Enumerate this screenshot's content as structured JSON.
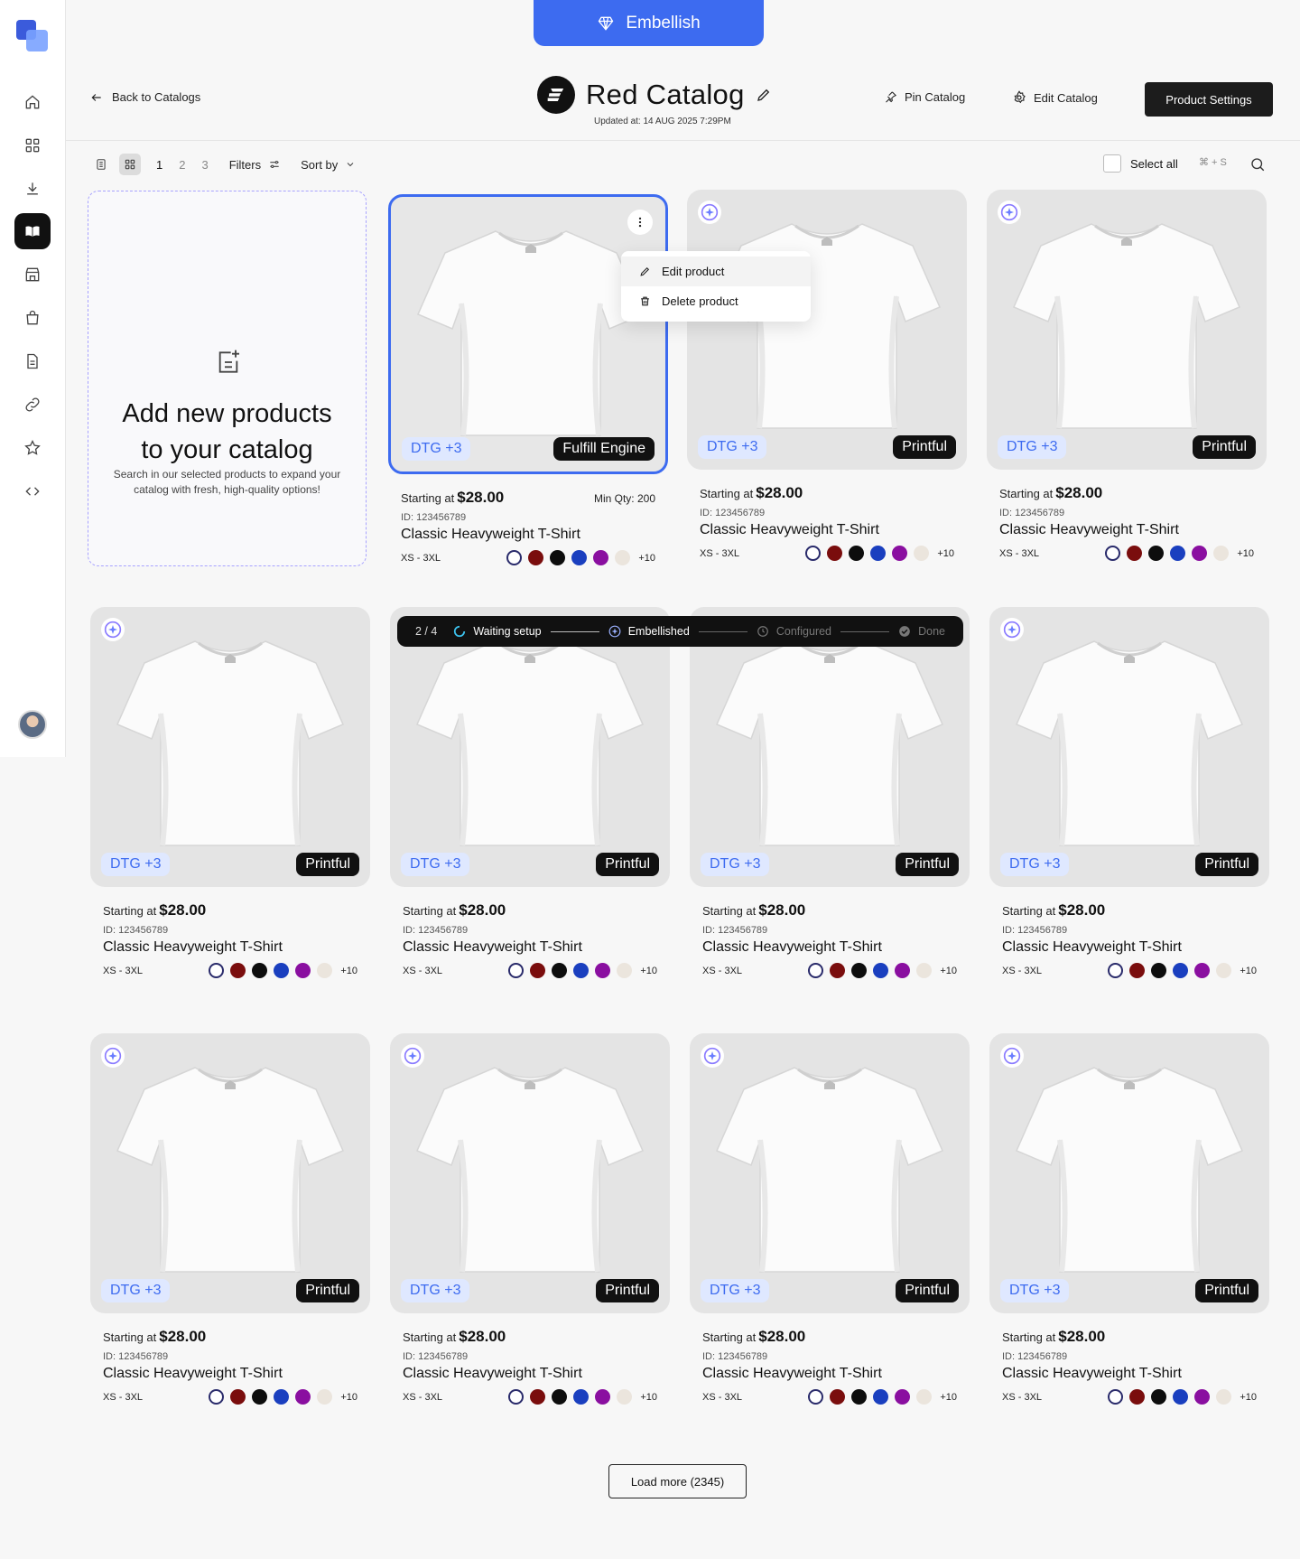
{
  "embellish": {
    "label": "Embellish"
  },
  "header": {
    "back_label": "Back to Catalogs",
    "title": "Red Catalog",
    "updated": "Updated at: 14 AUG 2025 7:29PM",
    "pin_label": "Pin Catalog",
    "edit_label": "Edit Catalog",
    "settings_label": "Product Settings"
  },
  "toolbar": {
    "pages": [
      "1",
      "2",
      "3"
    ],
    "filters_label": "Filters",
    "sort_label": "Sort by",
    "select_all_label": "Select all",
    "shortcut": "⌘ + S"
  },
  "add_card": {
    "title_line1": "Add new products",
    "title_line2": "to your catalog",
    "subtitle": "Search in our selected products to expand your catalog with fresh, high-quality options!"
  },
  "context_menu": {
    "edit": "Edit product",
    "delete": "Delete product"
  },
  "progress": {
    "count": "2 / 4",
    "steps": [
      "Waiting setup",
      "Embellished",
      "Configured",
      "Done"
    ]
  },
  "product": {
    "starting": "Starting at",
    "price": "$28.00",
    "id": "ID: 123456789",
    "name": "Classic Heavyweight T-Shirt",
    "sizes": "XS - 3XL",
    "dtg": "DTG  +3",
    "vendor": "Printful",
    "selected_vendor": "Fulfill Engine",
    "min_qty": "Min Qty: 200",
    "extra_colors": "+10",
    "swatch_colors": [
      "#ffffff",
      "#7a0d0d",
      "#0d0d0d",
      "#1a3fbf",
      "#8a0fa0",
      "#ebe5dd"
    ]
  },
  "load_more": {
    "label": "Load more (2345)"
  }
}
